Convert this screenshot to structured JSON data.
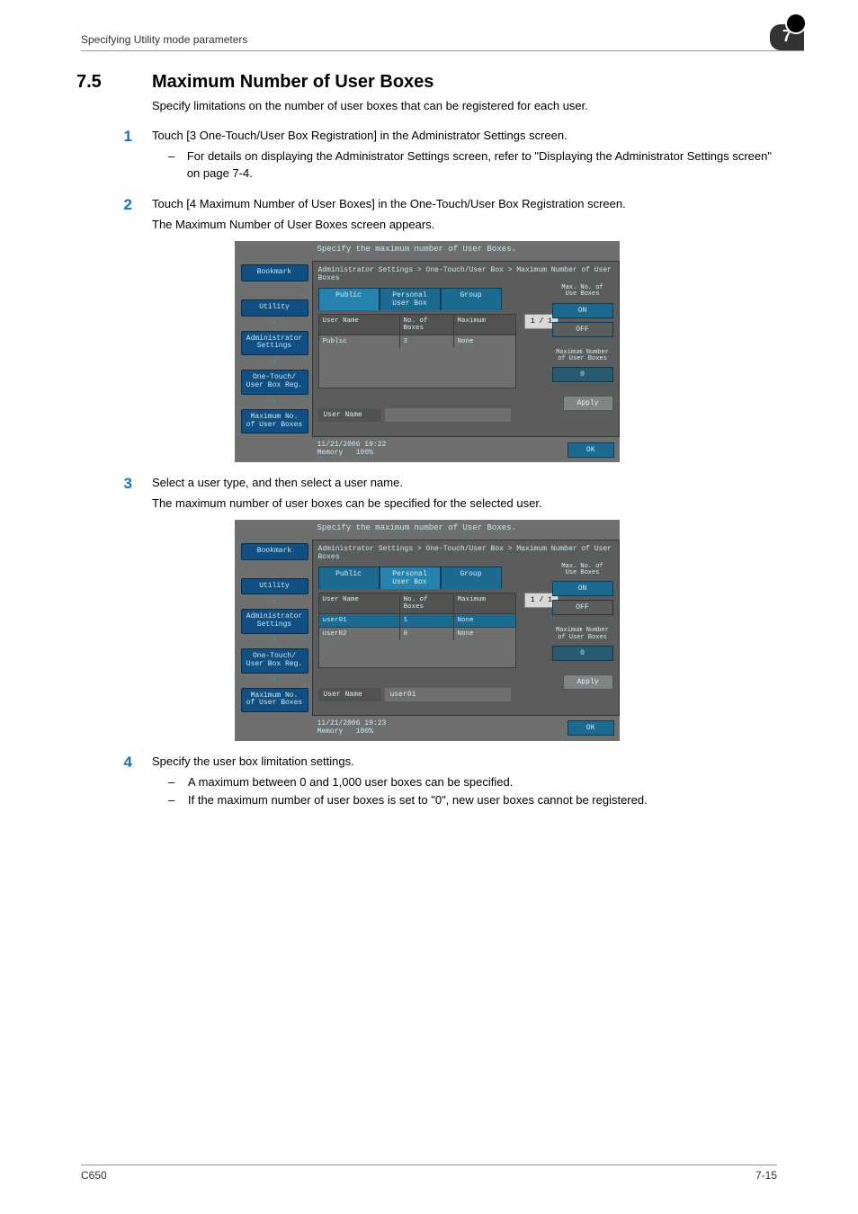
{
  "page": {
    "header_text": "Specifying Utility mode parameters",
    "chapter_badge": "7",
    "footer_left": "C650",
    "footer_right": "7-15"
  },
  "section": {
    "number": "7.5",
    "title": "Maximum Number of User Boxes",
    "intro": "Specify limitations on the number of user boxes that can be registered for each user."
  },
  "steps": [
    {
      "num": "1",
      "text": "Touch [3 One-Touch/User Box Registration] in the Administrator Settings screen.",
      "subs": [
        "For details on displaying the Administrator Settings screen, refer to \"Displaying the Administrator Settings screen\" on page 7-4."
      ]
    },
    {
      "num": "2",
      "text": "Touch [4 Maximum Number of User Boxes] in the One-Touch/User Box Registration screen.",
      "after": "The Maximum Number of User Boxes screen appears."
    },
    {
      "num": "3",
      "text": "Select a user type, and then select a user name.",
      "after": "The maximum number of user boxes can be specified for the selected user."
    },
    {
      "num": "4",
      "text": "Specify the user box limitation settings.",
      "subs": [
        "A maximum between 0 and 1,000 user boxes can be specified.",
        "If the maximum number of user boxes is set to \"0\", new user boxes cannot be registered."
      ]
    }
  ],
  "screens": {
    "common": {
      "title_line": "Specify the maximum number of User Boxes.",
      "breadcrumb": "Administrator Settings > One-Touch/User Box > Maximum Number of User Boxes",
      "sidebar": {
        "bookmark": "Bookmark",
        "utility": "Utility",
        "admin": "Administrator\nSettings",
        "onetouch": "One-Touch/\nUser Box Reg.",
        "maxno": "Maximum No.\nof User Boxes"
      },
      "tabs": {
        "public": "Public",
        "personal": "Personal\nUser Box",
        "group": "Group"
      },
      "columns": {
        "name": "User Name",
        "boxes": "No. of\nBoxes",
        "max": "Maximum"
      },
      "pager": "1 / 1",
      "right": {
        "label_max": "Max. No. of\nUse Boxes",
        "on": "ON",
        "off": "OFF",
        "label_num": "Maximum Number\nof User Boxes",
        "value": "0"
      },
      "uname_label": "User Name",
      "apply": "Apply",
      "ok": "OK",
      "foot_memory": "Memory",
      "foot_mempct": "100%"
    },
    "s1": {
      "active_tab": "public",
      "rows": [
        {
          "name": "Public",
          "boxes": "3",
          "max": "None"
        }
      ],
      "uname_value": "",
      "timestamp": "11/21/2006   19:22"
    },
    "s2": {
      "active_tab": "personal",
      "rows": [
        {
          "name": "user01",
          "boxes": "1",
          "max": "None",
          "selected": true
        },
        {
          "name": "user02",
          "boxes": "0",
          "max": "None"
        }
      ],
      "uname_value": "user01",
      "timestamp": "11/21/2006   19:23"
    }
  }
}
